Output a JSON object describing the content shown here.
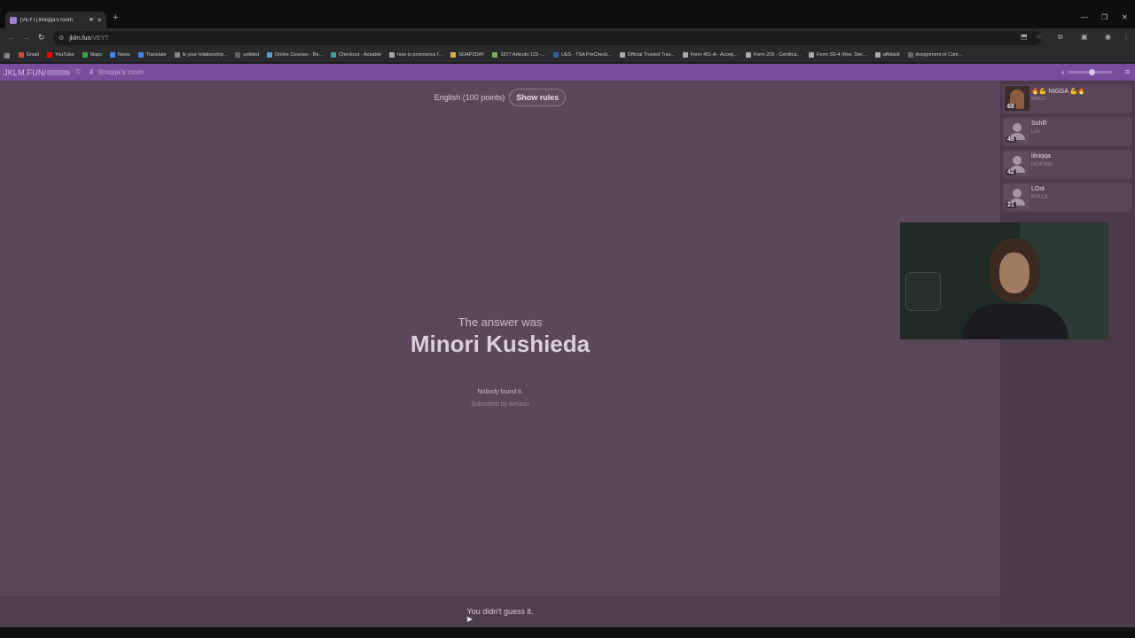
{
  "browser": {
    "tab_title": "[VEYT] lilniqqa's room",
    "url_host": "jklm.fun",
    "url_path": "/VEYT",
    "bookmarks": [
      {
        "label": "Gmail",
        "color": "#d44638"
      },
      {
        "label": "YouTube",
        "color": "#ff0000"
      },
      {
        "label": "Maps",
        "color": "#34a853"
      },
      {
        "label": "News",
        "color": "#4285f4"
      },
      {
        "label": "Translate",
        "color": "#4285f4"
      },
      {
        "label": "Is your relationship...",
        "color": "#888888"
      },
      {
        "label": "untitled",
        "color": "#666666"
      },
      {
        "label": "Online Courses - Be...",
        "color": "#5aa0d8"
      },
      {
        "label": "Checkout - Aceable",
        "color": "#3aa0a0"
      },
      {
        "label": "how to pronounce f...",
        "color": "#aaaaaa"
      },
      {
        "label": "SOAP2DAY",
        "color": "#e0b040"
      },
      {
        "label": "1577 Articulo 123 -...",
        "color": "#7ab060"
      },
      {
        "label": "UES - TSA PreCheck...",
        "color": "#3060a0"
      },
      {
        "label": "Official Trusted Trav...",
        "color": "#aaaaaa"
      },
      {
        "label": "Form 401-A - Accep...",
        "color": "#aaaaaa"
      },
      {
        "label": "Form 205 - Certifica...",
        "color": "#aaaaaa"
      },
      {
        "label": "Form SS-4 (Rev. Dec...",
        "color": "#aaaaaa"
      },
      {
        "label": "affidavit",
        "color": "#aaaaaa"
      },
      {
        "label": "Assignment of Cont...",
        "color": "#666666"
      }
    ]
  },
  "header": {
    "brand": "JKLM.FUN/",
    "player_count": "4",
    "room_name": "lilniqqa's room",
    "volume_level": 0.55
  },
  "game": {
    "mode_text": "English (100 points)",
    "show_rules_label": "Show rules",
    "answer_label": "The answer was",
    "answer": "Minori Kushieda",
    "nobody_found": "Nobody found it.",
    "submitted_by": "Submitted by Atelasu",
    "guess_status": "You didn't guess it."
  },
  "players": [
    {
      "score": "68",
      "prefix": "🔥💪",
      "name": "NIGGA",
      "suffix": "💪🔥",
      "sub": "MIKU",
      "photo": true
    },
    {
      "score": "49",
      "prefix": "",
      "name": "Sohlll",
      "suffix": "",
      "sub": "LIA",
      "photo": false
    },
    {
      "score": "42",
      "prefix": "",
      "name": "lilniqqa",
      "suffix": "",
      "sub": "NORMA",
      "photo": false
    },
    {
      "score": "21",
      "prefix": "",
      "name": "LOst",
      "suffix": "",
      "sub": "RYUJI",
      "photo": false
    }
  ]
}
